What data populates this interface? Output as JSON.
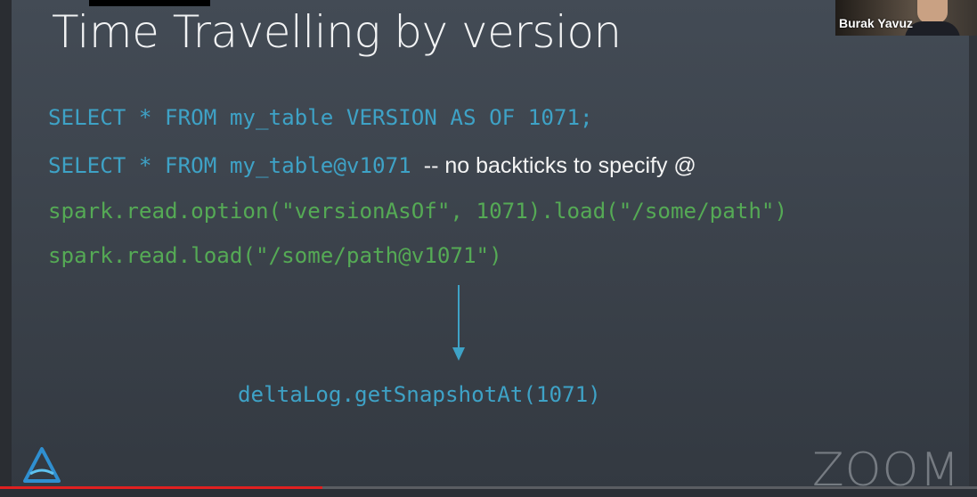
{
  "slide": {
    "title": "Time Travelling by version",
    "code_lines": [
      "SELECT * FROM my_table VERSION AS OF 1071;",
      "SELECT * FROM my_table@v1071",
      "spark.read.option(\"versionAsOf\", 1071).load(\"/some/path\")",
      "spark.read.load(\"/some/path@v1071\")"
    ],
    "comment": "-- no backticks to specify @",
    "result": "deltaLog.getSnapshotAt(1071)"
  },
  "video": {
    "participant_name": "Burak Yavuz"
  },
  "watermark": {
    "text": "ZOOM"
  },
  "playback": {
    "progress_fraction": 0.33
  },
  "colors": {
    "sql": "#3ea2c6",
    "python": "#55aa55",
    "comment": "#f4f4f4",
    "title": "#f2f3f4",
    "progress": "#e02020"
  },
  "icons": {
    "logo": "delta-lake-logo-icon",
    "arrow": "down-arrow-icon"
  }
}
